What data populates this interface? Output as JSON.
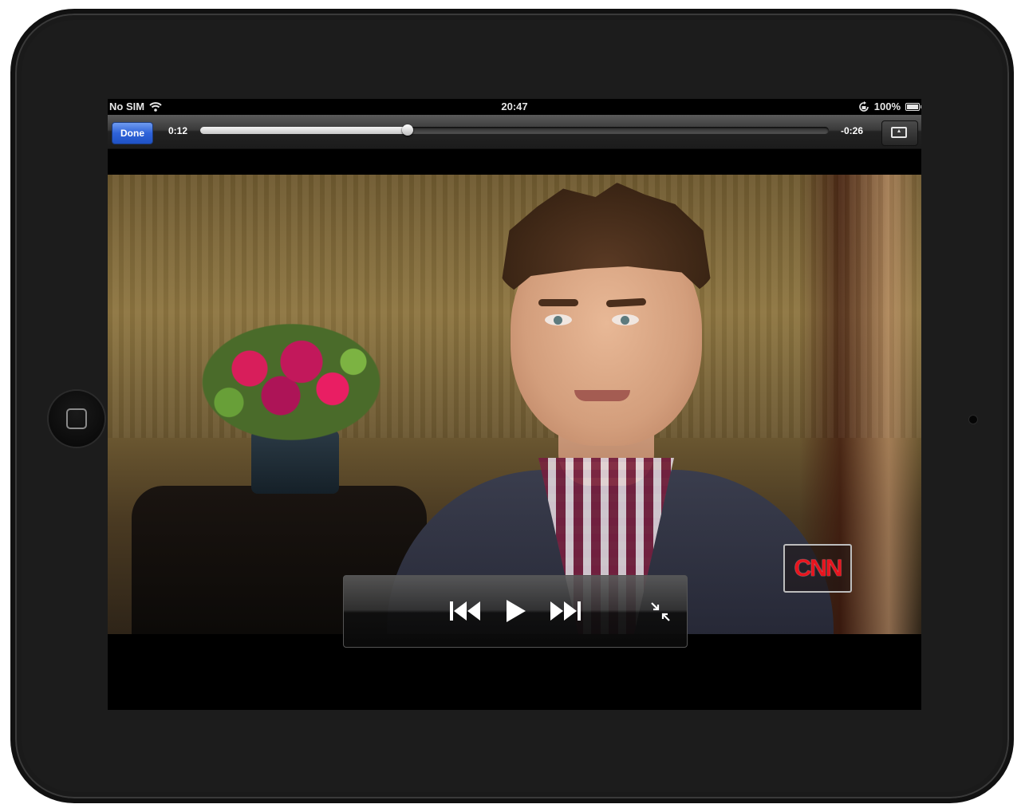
{
  "status_bar": {
    "carrier": "No SIM",
    "time": "20:47",
    "battery_percent": "100%"
  },
  "toolbar": {
    "done_label": "Done",
    "elapsed": "0:12",
    "remaining": "-0:26",
    "progress_fraction": 0.33
  },
  "video": {
    "network_bug": "CNN"
  },
  "icons": {
    "wifi": "wifi-icon",
    "rotation_lock": "rotation-lock-icon",
    "battery": "battery-icon",
    "aspect": "aspect-ratio-icon",
    "prev": "skip-back-icon",
    "play": "play-icon",
    "next": "skip-forward-icon",
    "exit_fullscreen": "exit-fullscreen-icon",
    "home": "home-button-icon"
  },
  "colors": {
    "done_button": "#2f63d9",
    "cnn_red": "#e8141e",
    "device_frame": "#1c1c1c"
  }
}
